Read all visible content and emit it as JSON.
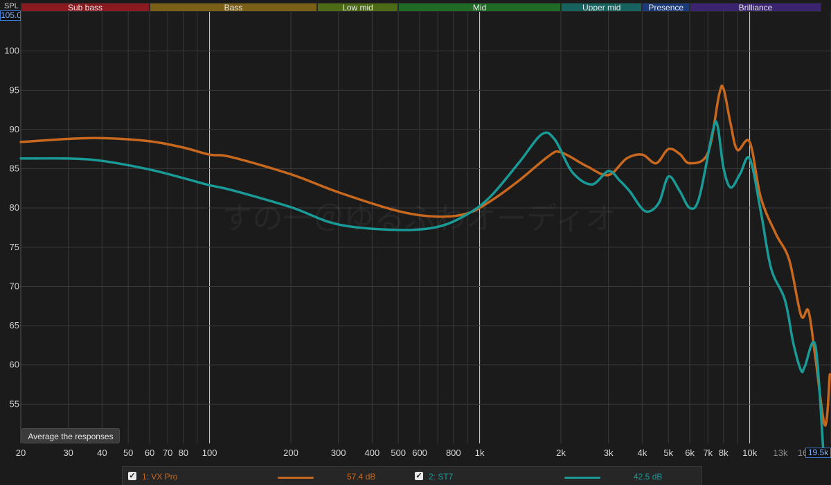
{
  "bands": [
    {
      "label": "Sub bass",
      "from": 20,
      "to": 60,
      "color": "#8a1a1f"
    },
    {
      "label": "Bass",
      "from": 60,
      "to": 250,
      "color": "#7a6016"
    },
    {
      "label": "Low mid",
      "from": 250,
      "to": 500,
      "color": "#4d6a14"
    },
    {
      "label": "Mid",
      "from": 500,
      "to": 2000,
      "color": "#1f6a24"
    },
    {
      "label": "Upper mid",
      "from": 2000,
      "to": 4000,
      "color": "#16625e"
    },
    {
      "label": "Presence",
      "from": 4000,
      "to": 6000,
      "color": "#1c3a78"
    },
    {
      "label": "Brilliance",
      "from": 6000,
      "to": 20000,
      "color": "#3a2470"
    }
  ],
  "spl_label": "SPL",
  "spl_value": "105.00",
  "x_max_label": "19.5k",
  "avg_button": "Average the responses",
  "watermark": "すの一＠ゆるふわオーディオ",
  "legend": [
    {
      "label": "1: VX Pro",
      "value": "57.4 dB",
      "color": "#c8681f"
    },
    {
      "label": "2: ST7",
      "value": "42.5 dB",
      "color": "#1a9a96"
    }
  ],
  "chart_data": {
    "type": "line",
    "x_scale": "log",
    "xlim": [
      20,
      20000
    ],
    "ylim": [
      50,
      105
    ],
    "ylabel": "SPL",
    "grid": true,
    "x_ticks": [
      20,
      30,
      40,
      50,
      60,
      70,
      80,
      100,
      200,
      300,
      400,
      500,
      600,
      800,
      1000,
      2000,
      3000,
      4000,
      5000,
      6000,
      7000,
      8000,
      10000,
      13000,
      16000
    ],
    "x_tick_labels": [
      "20",
      "30",
      "40",
      "50",
      "60",
      "70",
      "80",
      "100",
      "200",
      "300",
      "400",
      "500",
      "600",
      "800",
      "1k",
      "2k",
      "3k",
      "4k",
      "5k",
      "6k",
      "7k",
      "8k",
      "10k",
      "13k",
      "16k"
    ],
    "y_ticks": [
      55,
      60,
      65,
      70,
      75,
      80,
      85,
      90,
      95,
      100
    ],
    "series": [
      {
        "name": "1: VX Pro",
        "color": "#c8681f",
        "x": [
          20,
          30,
          40,
          60,
          80,
          100,
          120,
          200,
          300,
          500,
          700,
          900,
          1100,
          1400,
          1800,
          2000,
          2500,
          3000,
          3500,
          4000,
          4500,
          5000,
          5500,
          6000,
          7000,
          7700,
          8000,
          8500,
          9000,
          10000,
          11000,
          12500,
          14000,
          15500,
          16500,
          17500,
          19000,
          19800
        ],
        "y": [
          88.4,
          88.8,
          88.9,
          88.5,
          87.7,
          86.8,
          86.5,
          84.3,
          82.0,
          79.6,
          78.9,
          79.3,
          80.9,
          83.5,
          86.6,
          87.1,
          85.3,
          84.2,
          86.3,
          86.8,
          85.7,
          87.5,
          86.9,
          85.7,
          87.0,
          94.4,
          95.2,
          90.7,
          87.4,
          88.4,
          81.3,
          76.7,
          73.4,
          66.3,
          66.9,
          61.0,
          52.3,
          58.8
        ]
      },
      {
        "name": "2: ST7",
        "color": "#1a9a96",
        "x": [
          20,
          30,
          40,
          60,
          80,
          100,
          120,
          200,
          300,
          500,
          700,
          900,
          1100,
          1400,
          1700,
          1900,
          2200,
          2600,
          3000,
          3300,
          3600,
          4100,
          4600,
          5000,
          5500,
          6000,
          6500,
          7300,
          7600,
          8000,
          8500,
          9200,
          10000,
          11000,
          12000,
          13500,
          14500,
          15500,
          16000,
          17500,
          18700
        ],
        "y": [
          86.3,
          86.3,
          86.0,
          84.9,
          83.8,
          82.9,
          82.3,
          80.1,
          77.9,
          77.2,
          77.6,
          79.2,
          81.5,
          85.8,
          89.4,
          88.7,
          84.6,
          83.0,
          84.7,
          83.5,
          82.1,
          79.6,
          80.6,
          84.0,
          82.2,
          80.0,
          81.3,
          89.8,
          90.5,
          85.1,
          82.6,
          84.3,
          86.3,
          79.5,
          72.3,
          68.3,
          62.8,
          59.3,
          59.8,
          62.5,
          49.5
        ]
      }
    ]
  }
}
